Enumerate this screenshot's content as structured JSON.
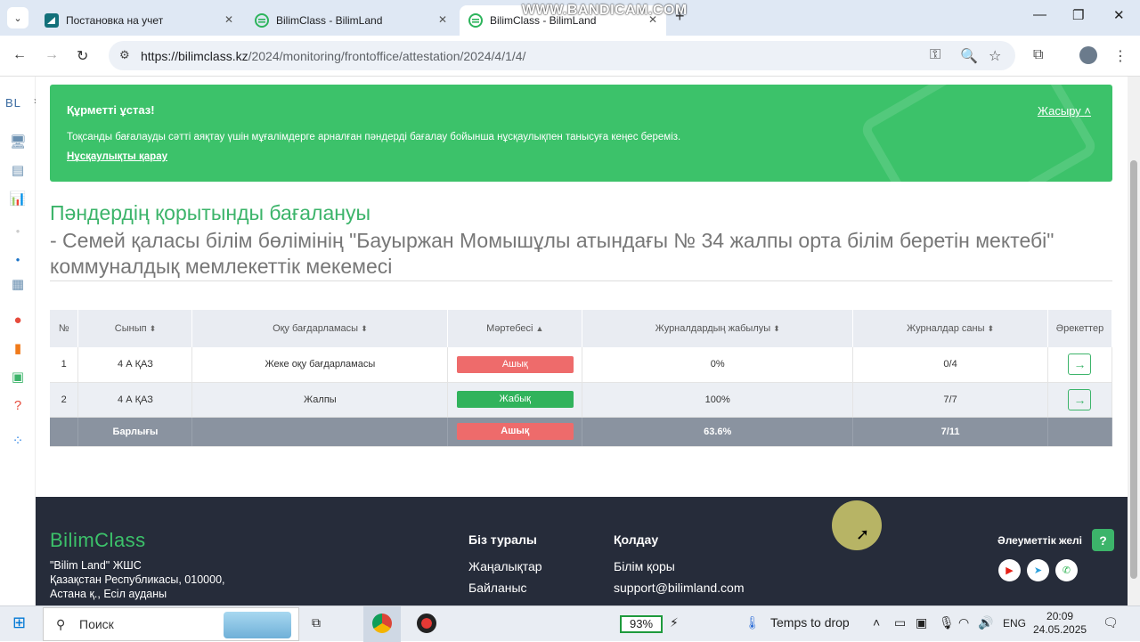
{
  "browser": {
    "tabs": [
      {
        "title": "Постановка на учет",
        "active": false
      },
      {
        "title": "BilimClass - BilimLand",
        "active": false
      },
      {
        "title": "BilimClass - BilimLand",
        "active": true
      }
    ],
    "watermark": "WWW.BANDICAM.COM",
    "url_host": "https://bilimclass.kz",
    "url_path": "/2024/monitoring/frontoffice/attestation/2024/4/1/4/"
  },
  "sidebar": {
    "logo": "BL"
  },
  "banner": {
    "heading": "Құрметті ұстаз!",
    "text": "Тоқсанды бағалауды сәтті аяқтау үшін мұғалімдерге арналған пәндерді бағалау бойынша нұсқаулықпен танысуға кеңес береміз.",
    "link": "Нұсқаулықты қарау",
    "hide_label": "Жасыру"
  },
  "page": {
    "title": "Пәндердің қорытынды бағалануы",
    "subtitle": "- Семей қаласы білім бөлімінің \"Бауыржан Момышұлы атындағы № 34 жалпы орта білім беретін мектебі\" коммуналдық мемлекеттік мекемесі"
  },
  "table": {
    "headers": [
      "№",
      "Сынып",
      "Оқу бағдарламасы",
      "Мәртебесі",
      "Журналдардың жабылуы",
      "Журналдар саны",
      "Әрекеттер"
    ],
    "rows": [
      {
        "no": "1",
        "class": "4 А ҚАЗ",
        "program": "Жеке оқу бағдарламасы",
        "status": "Ашық",
        "closure": "0%",
        "count": "0/4"
      },
      {
        "no": "2",
        "class": "4 А ҚАЗ",
        "program": "Жалпы",
        "status": "Жабық",
        "closure": "100%",
        "count": "7/7"
      }
    ],
    "total": {
      "label": "Барлығы",
      "status": "Ашық",
      "closure": "63.6%",
      "count": "7/11"
    }
  },
  "footer": {
    "logo": "BilimClass",
    "company": "\"Bilim Land\" ЖШС",
    "address1": "Қазақстан Республикасы, 010000,",
    "address2": "Астана қ., Есіл ауданы",
    "about_heading": "Біз туралы",
    "about_links": [
      "Жаңалықтар",
      "Байланыс"
    ],
    "support_heading": "Қолдау",
    "support_links": [
      "Білім қоры",
      "support@bilimland.com"
    ],
    "social_heading": "Әлеуметтік желі"
  },
  "taskbar": {
    "search_placeholder": "Поиск",
    "battery": "93%",
    "weather": "Temps to drop",
    "lang": "ENG",
    "time": "20:09",
    "date": "24.05.2025"
  },
  "colors": {
    "accent": "#3cc26a",
    "open_status": "#ee6b6b",
    "closed_status": "#31b35c",
    "footer_bg": "#262c3a"
  }
}
